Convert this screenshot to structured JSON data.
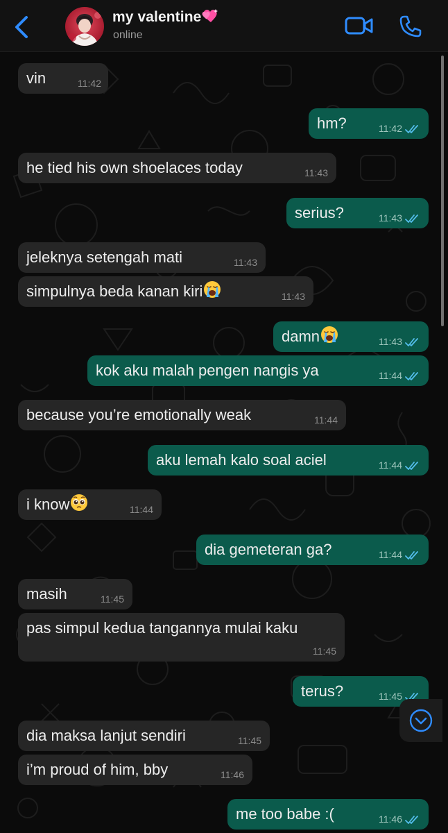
{
  "header": {
    "back_icon": "chevron-left-icon",
    "contact_name": "my valentine",
    "name_emoji": "sparkling-heart-emoji",
    "status": "online",
    "video_icon": "video-call-icon",
    "phone_icon": "phone-call-icon"
  },
  "colors": {
    "accent": "#2f8cff",
    "incoming_bubble": "#262626",
    "outgoing_bubble": "#0b5b4c",
    "background": "#0b0b0b",
    "read_ticks": "#53bdeb"
  },
  "messages": [
    {
      "direction": "in",
      "text": "vin",
      "time": "11:42"
    },
    {
      "direction": "out",
      "text": "hm?",
      "time": "11:42",
      "read": true
    },
    {
      "direction": "in",
      "text": "he tied his own shoelaces today",
      "time": "11:43"
    },
    {
      "direction": "out",
      "text": "serius?",
      "time": "11:43",
      "read": true
    },
    {
      "direction": "in",
      "text": "jeleknya setengah mati",
      "time": "11:43"
    },
    {
      "direction": "in",
      "text": "simpulnya beda kanan kiri",
      "emoji": "loudly-crying-face",
      "time": "11:43"
    },
    {
      "direction": "out",
      "text": "damn",
      "emoji": "loudly-crying-face",
      "time": "11:43",
      "read": true
    },
    {
      "direction": "out",
      "text": "kok aku malah pengen nangis ya",
      "time": "11:44",
      "read": true
    },
    {
      "direction": "in",
      "text": "because you’re emotionally weak",
      "time": "11:44"
    },
    {
      "direction": "out",
      "text": "aku lemah kalo soal aciel",
      "time": "11:44",
      "read": true
    },
    {
      "direction": "in",
      "text": "i know",
      "emoji": "pleading-face",
      "time": "11:44"
    },
    {
      "direction": "out",
      "text": "dia gemeteran ga?",
      "time": "11:44",
      "read": true
    },
    {
      "direction": "in",
      "text": "masih",
      "time": "11:45"
    },
    {
      "direction": "in",
      "text": "pas simpul kedua tangannya mulai kaku",
      "time": "11:45"
    },
    {
      "direction": "out",
      "text": "terus?",
      "time": "11:45",
      "read": true
    },
    {
      "direction": "in",
      "text": "dia maksa lanjut sendiri",
      "time": "11:45"
    },
    {
      "direction": "in",
      "text": "i’m proud of him, bby",
      "time": "11:46"
    },
    {
      "direction": "out",
      "text": "me too babe :(",
      "time": "11:46",
      "read": true
    }
  ],
  "scroll_down_icon": "chevron-down-circle-icon"
}
